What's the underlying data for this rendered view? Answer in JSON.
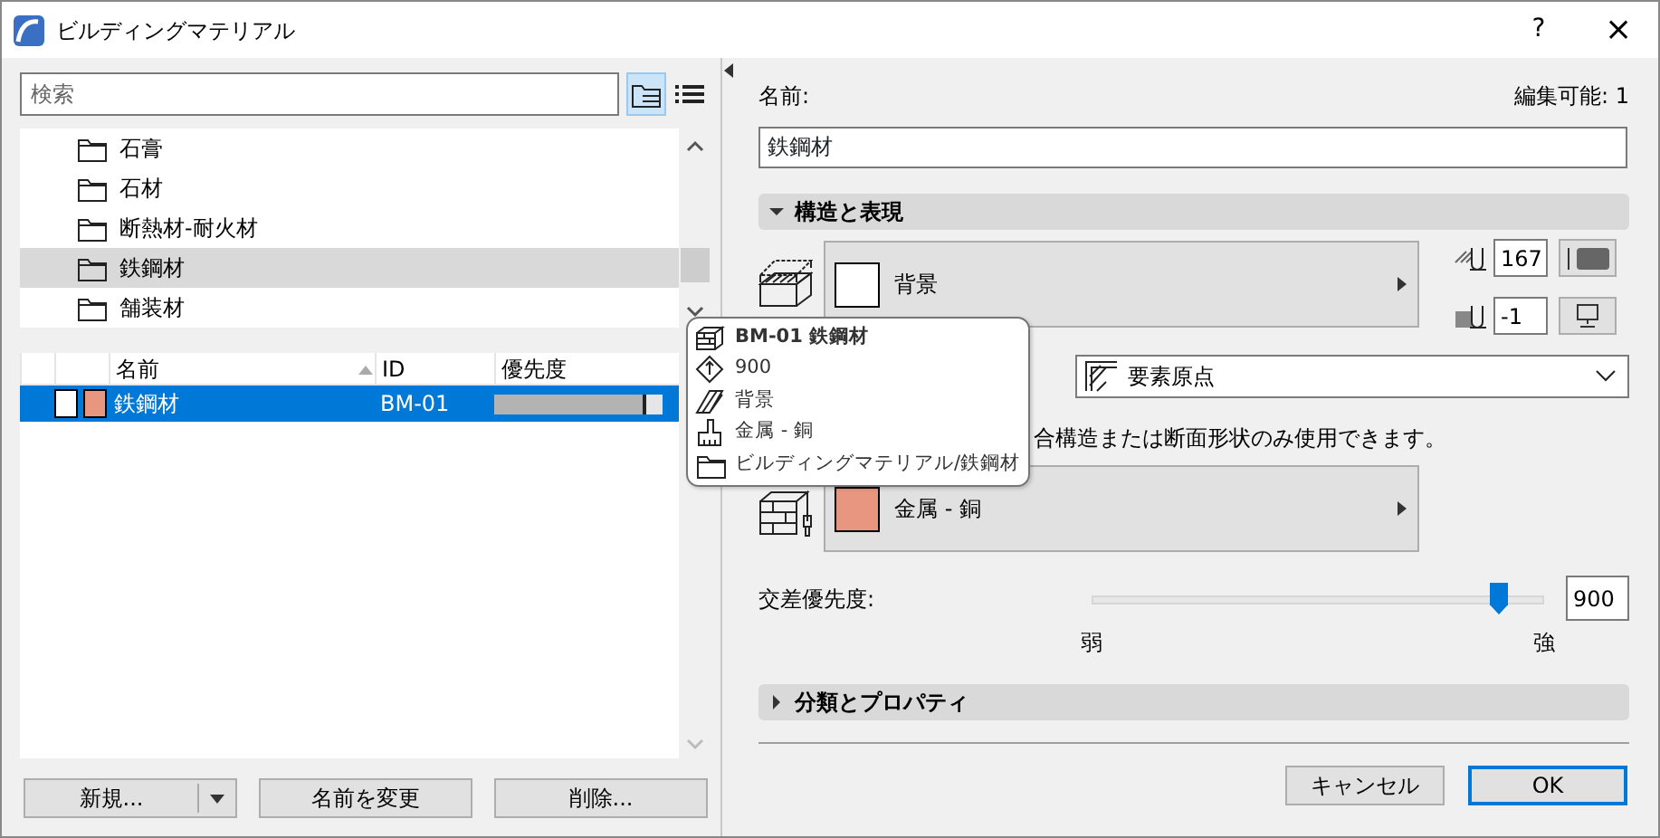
{
  "window": {
    "title": "ビルディングマテリアル",
    "help": "?",
    "close": "×"
  },
  "search": {
    "placeholder": "検索"
  },
  "view_toggle": [
    {
      "kind": "tree",
      "selected": true
    },
    {
      "kind": "list",
      "selected": false
    }
  ],
  "folders": [
    {
      "label": "石膏",
      "selected": false
    },
    {
      "label": "石材",
      "selected": false
    },
    {
      "label": "断熱材-耐火材",
      "selected": false
    },
    {
      "label": "鉄鋼材",
      "selected": true
    },
    {
      "label": "舗装材",
      "selected": false
    }
  ],
  "table": {
    "columns": [
      "名前",
      "ID",
      "優先度"
    ],
    "rows": [
      {
        "name": "鉄鋼材",
        "id": "BM-01",
        "level": 0.9,
        "selected": true,
        "color": "#e8967f"
      }
    ]
  },
  "left_buttons": [
    {
      "kind": "split",
      "label": "新規..."
    },
    {
      "kind": "plain",
      "label": "名前を変更"
    },
    {
      "kind": "plain",
      "label": "削除..."
    }
  ],
  "tooltip": [
    {
      "kind": "title",
      "text": "BM-01 鉄鋼材"
    },
    {
      "kind": "priority",
      "text": "900"
    },
    {
      "kind": "fill",
      "text": "背景"
    },
    {
      "kind": "surface",
      "text": "金属 - 銅"
    },
    {
      "kind": "folder",
      "text": "ビルディングマテリアル/鉄鋼材"
    }
  ],
  "details": {
    "name_label": "名前:",
    "editable": "編集可能: 1",
    "name_value": "鉄鋼材",
    "section_structure": {
      "title": "構造と表現",
      "expanded": true
    },
    "cut_fill": {
      "label": "背景"
    },
    "pen_cut": "167",
    "pen_background": "-1",
    "origin": "要素原点",
    "note": "合構造または断面形状のみ使用できます。",
    "surface": {
      "label": "金属 - 銅",
      "color": "#e8967f"
    },
    "priority": {
      "label": "交差優先度:",
      "level": 0.9,
      "value": "900",
      "min_label": "弱",
      "max_label": "強"
    },
    "section_classification": {
      "title": "分類とプロパティ",
      "expanded": false
    }
  },
  "footer_buttons": [
    {
      "label": "キャンセル",
      "default": false
    },
    {
      "label": "OK",
      "default": true
    }
  ]
}
